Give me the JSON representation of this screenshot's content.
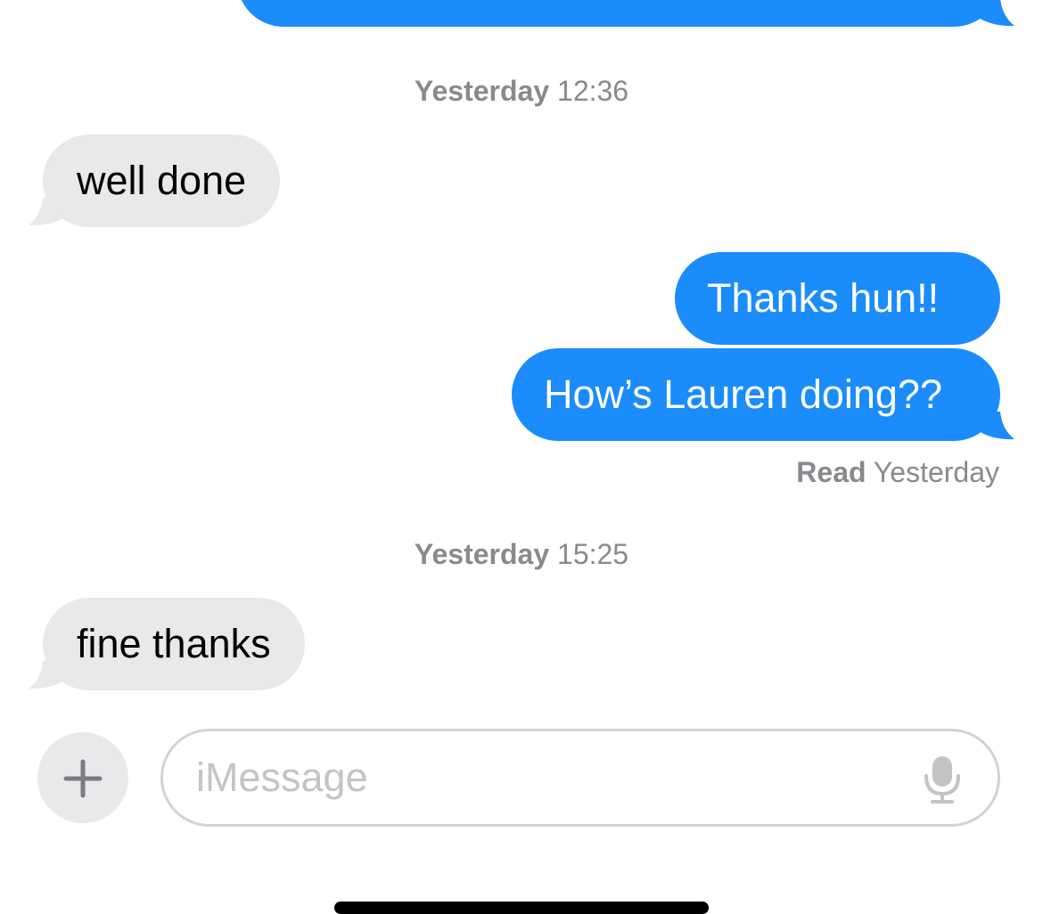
{
  "conversation": {
    "partial_top_message": "",
    "groups": [
      {
        "timestamp_day": "Yesterday",
        "timestamp_time": "12:36"
      },
      {
        "timestamp_day": "Yesterday",
        "timestamp_time": "15:25"
      }
    ],
    "messages": [
      {
        "direction": "incoming",
        "text": "well done"
      },
      {
        "direction": "outgoing",
        "text": "Thanks hun!!"
      },
      {
        "direction": "outgoing",
        "text": "How’s Lauren doing??"
      },
      {
        "direction": "incoming",
        "text": "fine thanks"
      }
    ],
    "read_receipt": {
      "label": "Read",
      "time": "Yesterday"
    }
  },
  "composer": {
    "add_icon": "plus-icon",
    "placeholder": "iMessage",
    "value": "",
    "mic_icon": "microphone-icon"
  },
  "colors": {
    "outgoing_bubble": "#1a8cfb",
    "incoming_bubble": "#e9e9eb",
    "timestamp_text": "#8a8a8e",
    "placeholder_text": "#c4c4c7"
  }
}
